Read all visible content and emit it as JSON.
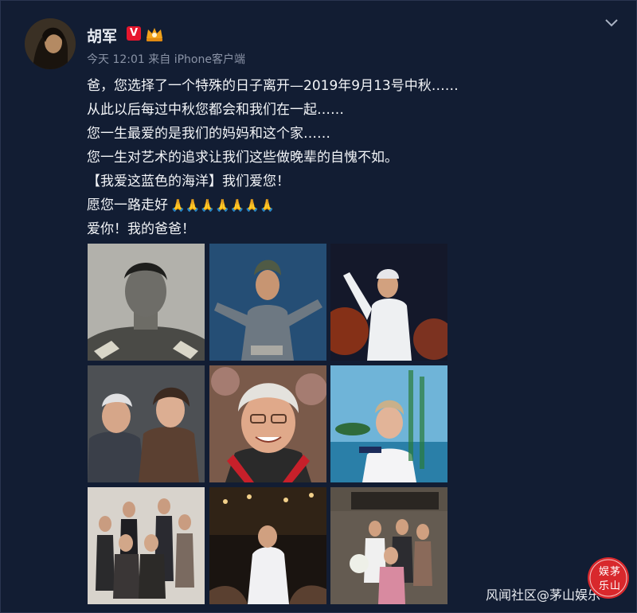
{
  "post": {
    "author": "胡军",
    "verified_label": "V",
    "meta": "今天 12:01 来自 iPhone客户端",
    "lines": [
      "爸，您选择了一个特殊的日子离开—2019年9月13号中秋……",
      "从此以后每过中秋您都会和我们在一起……",
      "您一生最爱的是我们的妈妈和这个家……",
      "您一生对艺术的追求让我们这些做晚辈的自愧不如。",
      "【我爱这蓝色的海洋】我们爱您！",
      "愿您一路走好",
      "爱你！我的爸爸！"
    ],
    "pray_emoji": "🙏🙏🙏🙏🙏🙏🙏"
  },
  "watermark": {
    "text": "风闻社区@茅山娱乐",
    "seal_text": "娱茅山乐"
  },
  "colors": {
    "background": "#121d33",
    "text": "#f2f4f7",
    "meta": "#8a93a6",
    "verified": "#e6162d",
    "seal": "#d8282c"
  }
}
